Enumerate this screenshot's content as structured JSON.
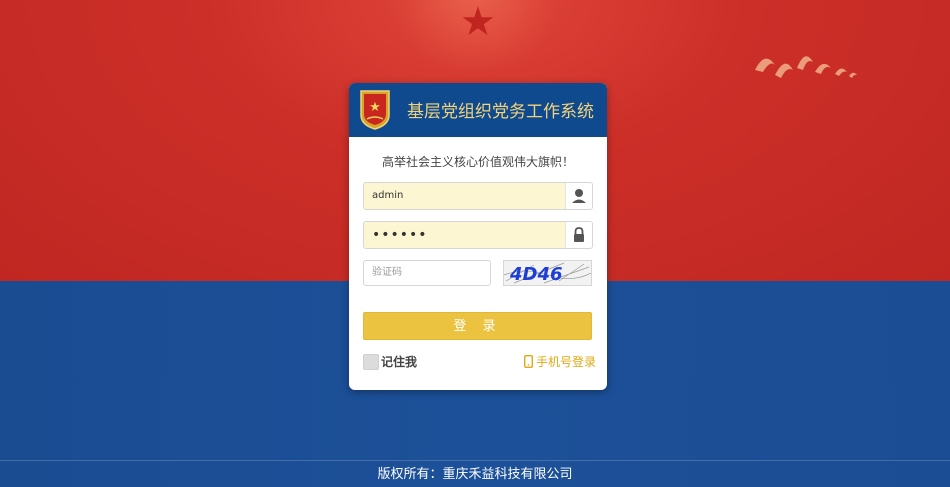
{
  "app": {
    "title": "基层党组织党务工作系统",
    "slogan": "高举社会主义核心价值观伟大旗帜！"
  },
  "form": {
    "username_value": "admin",
    "password_value": "••••••",
    "captcha_placeholder": "验证码",
    "captcha_text": "4D46",
    "login_label": "登 录",
    "remember_label": "记住我",
    "mobile_login_label": "手机号登录"
  },
  "footer": {
    "copyright": "版权所有：重庆禾益科技有限公司"
  },
  "colors": {
    "header_blue": "#0f4a8f",
    "title_gold": "#f3d37a",
    "button_yellow": "#ecc340",
    "link_orange": "#e0a914",
    "bg_red": "#c62a24",
    "bg_blue": "#1c4f96"
  },
  "icons": {
    "username": "user-icon",
    "password": "lock-icon",
    "mobile": "mobile-phone-icon",
    "badge": "party-emblem-icon"
  }
}
